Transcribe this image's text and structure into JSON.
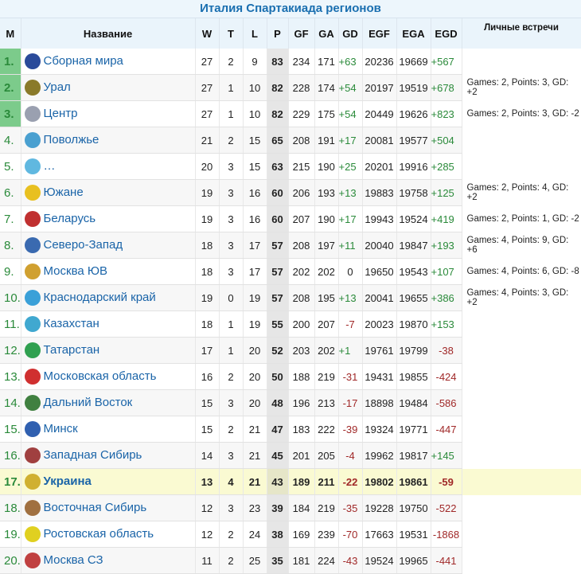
{
  "title": "Италия Спартакиада регионов",
  "columns": [
    "М",
    "Название",
    "W",
    "T",
    "L",
    "P",
    "GF",
    "GA",
    "GD",
    "EGF",
    "EGA",
    "EGD",
    "Личные встречи"
  ],
  "rows": [
    {
      "pos": "1.",
      "name": "Сборная мира",
      "w": "27",
      "t": "2",
      "l": "9",
      "p": "83",
      "gf": "234",
      "ga": "171",
      "gd": "+63",
      "egf": "20236",
      "ega": "19669",
      "egd": "+567",
      "h2h": "",
      "logo": "#2a4a9a"
    },
    {
      "pos": "2.",
      "name": "Урал",
      "w": "27",
      "t": "1",
      "l": "10",
      "p": "82",
      "gf": "228",
      "ga": "174",
      "gd": "+54",
      "egf": "20197",
      "ega": "19519",
      "egd": "+678",
      "h2h": "Games: 2, Points: 3, GD: +2",
      "logo": "#8a7a2a"
    },
    {
      "pos": "3.",
      "name": "Центр",
      "w": "27",
      "t": "1",
      "l": "10",
      "p": "82",
      "gf": "229",
      "ga": "175",
      "gd": "+54",
      "egf": "20449",
      "ega": "19626",
      "egd": "+823",
      "h2h": "Games: 2, Points: 3, GD: -2",
      "logo": "#9aa0b0"
    },
    {
      "pos": "4.",
      "name": "Поволжье",
      "w": "21",
      "t": "2",
      "l": "15",
      "p": "65",
      "gf": "208",
      "ga": "191",
      "gd": "+17",
      "egf": "20081",
      "ega": "19577",
      "egd": "+504",
      "h2h": "",
      "logo": "#4aa0d0"
    },
    {
      "pos": "5.",
      "name": "…",
      "w": "20",
      "t": "3",
      "l": "15",
      "p": "63",
      "gf": "215",
      "ga": "190",
      "gd": "+25",
      "egf": "20201",
      "ega": "19916",
      "egd": "+285",
      "h2h": "",
      "logo": "#60b8e0"
    },
    {
      "pos": "6.",
      "name": "Южане",
      "w": "19",
      "t": "3",
      "l": "16",
      "p": "60",
      "gf": "206",
      "ga": "193",
      "gd": "+13",
      "egf": "19883",
      "ega": "19758",
      "egd": "+125",
      "h2h": "Games: 2, Points: 4, GD: +2",
      "logo": "#e8c020"
    },
    {
      "pos": "7.",
      "name": "Беларусь",
      "w": "19",
      "t": "3",
      "l": "16",
      "p": "60",
      "gf": "207",
      "ga": "190",
      "gd": "+17",
      "egf": "19943",
      "ega": "19524",
      "egd": "+419",
      "h2h": "Games: 2, Points: 1, GD: -2",
      "logo": "#c03030"
    },
    {
      "pos": "8.",
      "name": "Северо-Запад",
      "w": "18",
      "t": "3",
      "l": "17",
      "p": "57",
      "gf": "208",
      "ga": "197",
      "gd": "+11",
      "egf": "20040",
      "ega": "19847",
      "egd": "+193",
      "h2h": "Games: 4, Points: 9, GD: +6",
      "logo": "#3a6ab0"
    },
    {
      "pos": "9.",
      "name": "Москва ЮВ",
      "w": "18",
      "t": "3",
      "l": "17",
      "p": "57",
      "gf": "202",
      "ga": "202",
      "gd": "0",
      "egf": "19650",
      "ega": "19543",
      "egd": "+107",
      "h2h": "Games: 4, Points: 6, GD: -8",
      "logo": "#d0a030"
    },
    {
      "pos": "10.",
      "name": "Краснодарский край",
      "w": "19",
      "t": "0",
      "l": "19",
      "p": "57",
      "gf": "208",
      "ga": "195",
      "gd": "+13",
      "egf": "20041",
      "ega": "19655",
      "egd": "+386",
      "h2h": "Games: 4, Points: 3, GD: +2",
      "logo": "#3aa0d8"
    },
    {
      "pos": "11.",
      "name": "Казахстан",
      "w": "18",
      "t": "1",
      "l": "19",
      "p": "55",
      "gf": "200",
      "ga": "207",
      "gd": "-7",
      "egf": "20023",
      "ega": "19870",
      "egd": "+153",
      "h2h": "",
      "logo": "#40a8d0"
    },
    {
      "pos": "12.",
      "name": "Татарстан",
      "w": "17",
      "t": "1",
      "l": "20",
      "p": "52",
      "gf": "203",
      "ga": "202",
      "gd": "+1",
      "egf": "19761",
      "ega": "19799",
      "egd": "-38",
      "h2h": "",
      "logo": "#30a050"
    },
    {
      "pos": "13.",
      "name": "Московская область",
      "w": "16",
      "t": "2",
      "l": "20",
      "p": "50",
      "gf": "188",
      "ga": "219",
      "gd": "-31",
      "egf": "19431",
      "ega": "19855",
      "egd": "-424",
      "h2h": "",
      "logo": "#d03030"
    },
    {
      "pos": "14.",
      "name": "Дальний Восток",
      "w": "15",
      "t": "3",
      "l": "20",
      "p": "48",
      "gf": "196",
      "ga": "213",
      "gd": "-17",
      "egf": "18898",
      "ega": "19484",
      "egd": "-586",
      "h2h": "",
      "logo": "#408040"
    },
    {
      "pos": "15.",
      "name": "Минск",
      "w": "15",
      "t": "2",
      "l": "21",
      "p": "47",
      "gf": "183",
      "ga": "222",
      "gd": "-39",
      "egf": "19324",
      "ega": "19771",
      "egd": "-447",
      "h2h": "",
      "logo": "#3060b0"
    },
    {
      "pos": "16.",
      "name": "Западная Сибирь",
      "w": "14",
      "t": "3",
      "l": "21",
      "p": "45",
      "gf": "201",
      "ga": "205",
      "gd": "-4",
      "egf": "19962",
      "ega": "19817",
      "egd": "+145",
      "h2h": "",
      "logo": "#a04040"
    },
    {
      "pos": "17.",
      "name": "Украина",
      "w": "13",
      "t": "4",
      "l": "21",
      "p": "43",
      "gf": "189",
      "ga": "211",
      "gd": "-22",
      "egf": "19802",
      "ega": "19861",
      "egd": "-59",
      "h2h": "",
      "logo": "#d0b030",
      "highlight": true
    },
    {
      "pos": "18.",
      "name": "Восточная Сибирь",
      "w": "12",
      "t": "3",
      "l": "23",
      "p": "39",
      "gf": "184",
      "ga": "219",
      "gd": "-35",
      "egf": "19228",
      "ega": "19750",
      "egd": "-522",
      "h2h": "",
      "logo": "#a07040"
    },
    {
      "pos": "19.",
      "name": "Ростовская область",
      "w": "12",
      "t": "2",
      "l": "24",
      "p": "38",
      "gf": "169",
      "ga": "239",
      "gd": "-70",
      "egf": "17663",
      "ega": "19531",
      "egd": "-1868",
      "h2h": "",
      "logo": "#e0d020"
    },
    {
      "pos": "20.",
      "name": "Москва СЗ",
      "w": "11",
      "t": "2",
      "l": "25",
      "p": "35",
      "gf": "181",
      "ga": "224",
      "gd": "-43",
      "egf": "19524",
      "ega": "19965",
      "egd": "-441",
      "h2h": "",
      "logo": "#c04040"
    }
  ]
}
